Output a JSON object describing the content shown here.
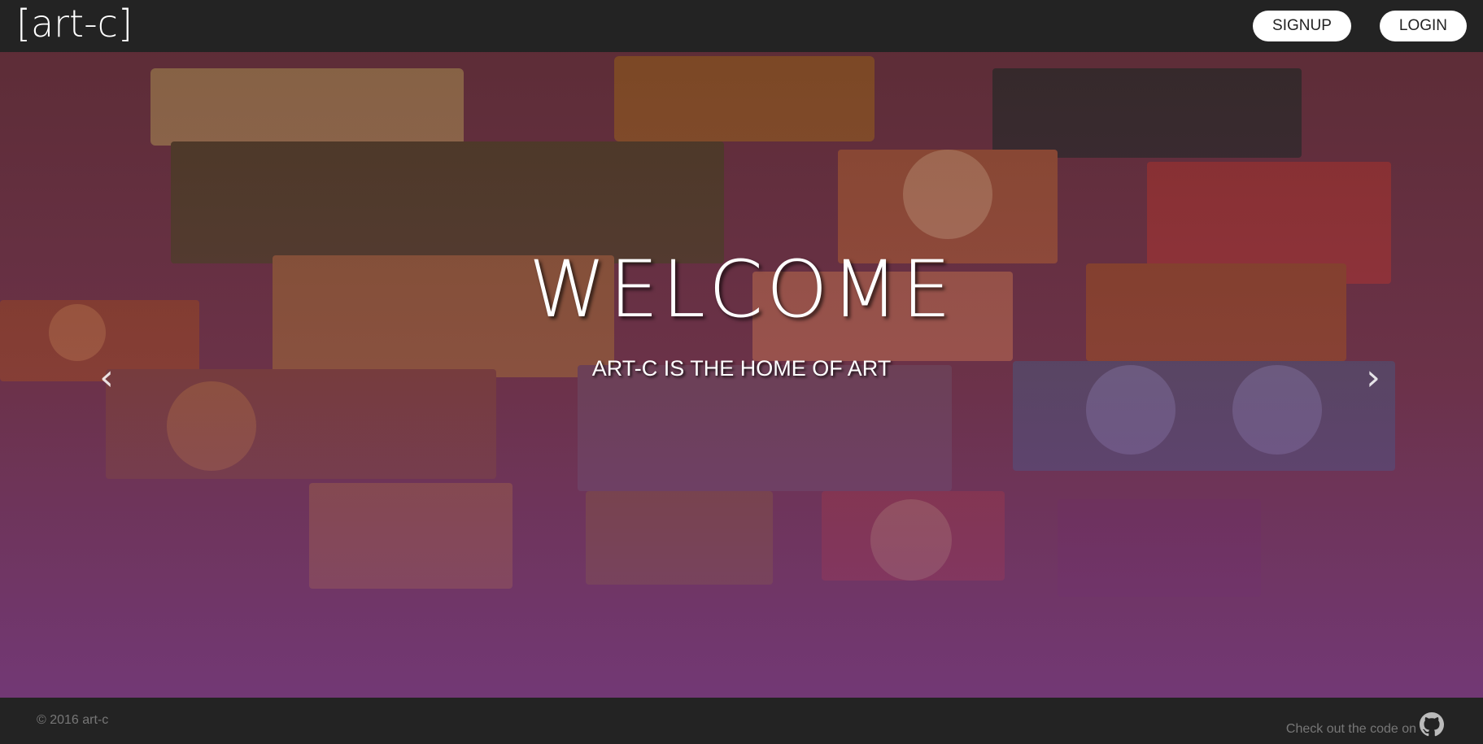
{
  "header": {
    "brand": "[art-c]",
    "signup_label": "SIGNUP",
    "login_label": "LOGIN"
  },
  "hero": {
    "title": "WELCOME",
    "subtitle": "ART-C IS THE HOME OF ART",
    "prev_icon": "chevron-left-icon",
    "next_icon": "chevron-right-icon"
  },
  "footer": {
    "copyright": "© 2016 art-c",
    "code_text": "Check out the code on",
    "code_icon": "github-icon"
  },
  "colors": {
    "navbar": "#232323",
    "button_bg": "#ffffff",
    "overlay_tint": "#6e378c"
  }
}
